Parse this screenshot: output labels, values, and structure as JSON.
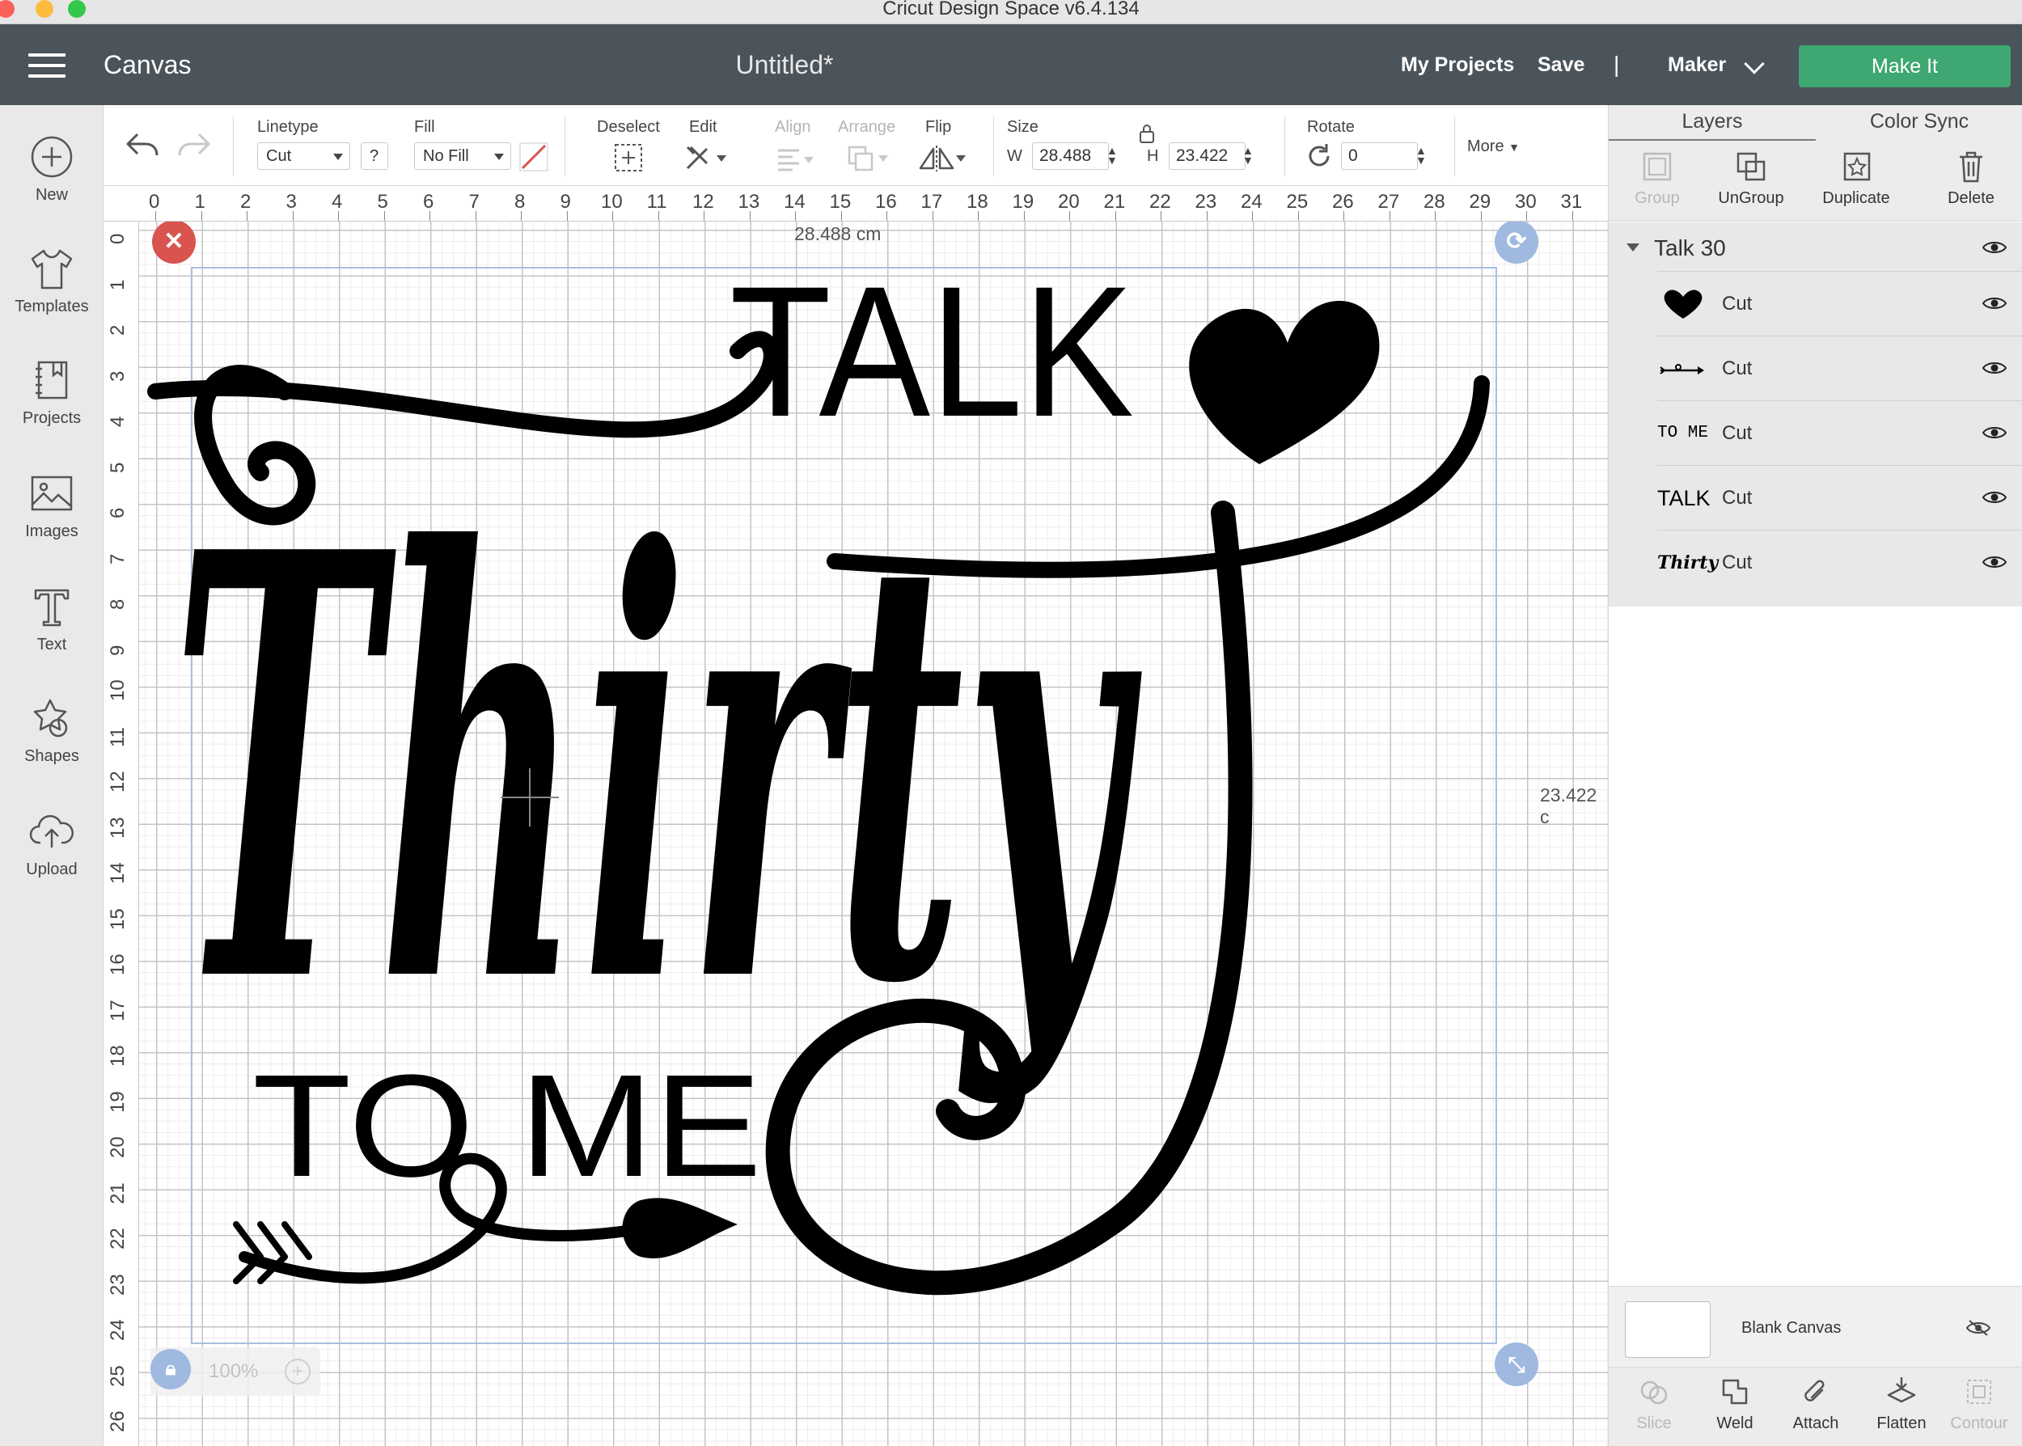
{
  "window": {
    "title": "Cricut Design Space  v6.4.134"
  },
  "header": {
    "app_name": "Canvas",
    "doc_title": "Untitled*",
    "my_projects": "My Projects",
    "save": "Save",
    "separator": "|",
    "machine": "Maker",
    "make_it": "Make It"
  },
  "sidebar": {
    "items": [
      {
        "label": "New",
        "icon": "plus-circle-icon"
      },
      {
        "label": "Templates",
        "icon": "tshirt-icon"
      },
      {
        "label": "Projects",
        "icon": "notebook-icon"
      },
      {
        "label": "Images",
        "icon": "image-icon"
      },
      {
        "label": "Text",
        "icon": "text-icon"
      },
      {
        "label": "Shapes",
        "icon": "shapes-icon"
      },
      {
        "label": "Upload",
        "icon": "cloud-upload-icon"
      }
    ]
  },
  "toolbar": {
    "linetype_label": "Linetype",
    "linetype_value": "Cut",
    "help": "?",
    "fill_label": "Fill",
    "fill_value": "No Fill",
    "deselect_label": "Deselect",
    "edit_label": "Edit",
    "align_label": "Align",
    "arrange_label": "Arrange",
    "flip_label": "Flip",
    "size_label": "Size",
    "w_label": "W",
    "w_value": "28.488",
    "h_label": "H",
    "h_value": "23.422",
    "rotate_label": "Rotate",
    "rotate_value": "0",
    "more_label": "More"
  },
  "ruler": {
    "top": [
      "0",
      "1",
      "2",
      "3",
      "4",
      "5",
      "6",
      "7",
      "8",
      "9",
      "10",
      "11",
      "12",
      "13",
      "14",
      "15",
      "16",
      "17",
      "18",
      "19",
      "20",
      "21",
      "22",
      "23",
      "24",
      "25",
      "26",
      "27",
      "28",
      "29",
      "30",
      "31"
    ],
    "left": [
      "0",
      "1",
      "2",
      "3",
      "4",
      "5",
      "6",
      "7",
      "8",
      "9",
      "10",
      "11",
      "12",
      "13",
      "14",
      "15",
      "16",
      "17",
      "18",
      "19",
      "20",
      "21",
      "22",
      "23",
      "24",
      "25",
      "26"
    ]
  },
  "canvas": {
    "width_readout": "28.488 cm",
    "height_readout": "23.422 c",
    "zoom": "100%",
    "design_text": {
      "talk": "TALK",
      "thirty": "Thirty",
      "to_me": "TO ME"
    }
  },
  "right_panel": {
    "tabs": [
      "Layers",
      "Color Sync"
    ],
    "actions": [
      {
        "label": "Group",
        "enabled": false,
        "icon": "group-icon"
      },
      {
        "label": "UnGroup",
        "enabled": true,
        "icon": "ungroup-icon"
      },
      {
        "label": "Duplicate",
        "enabled": true,
        "icon": "duplicate-icon"
      },
      {
        "label": "Delete",
        "enabled": true,
        "icon": "trash-icon"
      }
    ],
    "group": {
      "name": "Talk 30"
    },
    "layers": [
      {
        "thumb": "heart",
        "thumb_text": "",
        "label": "Cut"
      },
      {
        "thumb": "arrow",
        "thumb_text": "",
        "label": "Cut"
      },
      {
        "thumb": "text",
        "thumb_text": "TO ME",
        "label": "Cut"
      },
      {
        "thumb": "text",
        "thumb_text": "TALK",
        "label": "Cut"
      },
      {
        "thumb": "script",
        "thumb_text": "Thirty",
        "label": "Cut"
      }
    ],
    "blank_canvas": "Blank Canvas",
    "bottom_actions": [
      {
        "label": "Slice",
        "enabled": false,
        "icon": "slice-icon"
      },
      {
        "label": "Weld",
        "enabled": true,
        "icon": "weld-icon"
      },
      {
        "label": "Attach",
        "enabled": true,
        "icon": "paperclip-icon"
      },
      {
        "label": "Flatten",
        "enabled": true,
        "icon": "flatten-icon"
      },
      {
        "label": "Contour",
        "enabled": false,
        "icon": "contour-icon"
      }
    ]
  },
  "colors": {
    "header_bg": "#4b545b",
    "make_it": "#3fa771",
    "close_handle": "#d9534f",
    "handle_blue": "#9fb9e0"
  }
}
